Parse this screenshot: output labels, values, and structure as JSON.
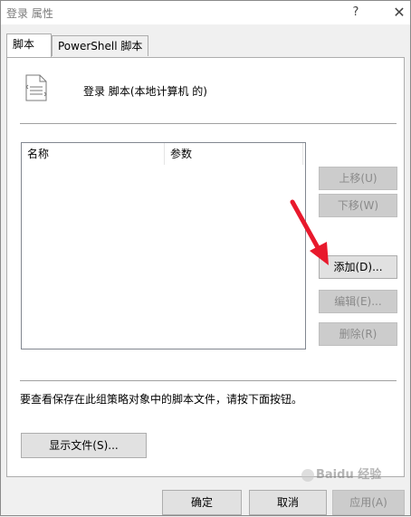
{
  "window": {
    "title": "登录 属性",
    "help_glyph": "?",
    "close_glyph": "✕"
  },
  "tabs": [
    {
      "label": "脚本"
    },
    {
      "label": "PowerShell 脚本"
    }
  ],
  "header": {
    "label": "登录 脚本(本地计算机 的)"
  },
  "list": {
    "columns": [
      "名称",
      "参数"
    ]
  },
  "side_buttons": {
    "up": "上移(U)",
    "down": "下移(W)",
    "add": "添加(D)...",
    "edit": "编辑(E)...",
    "remove": "删除(R)"
  },
  "info_text": "要查看保存在此组策略对象中的脚本文件，请按下面按钮。",
  "show_files_label": "显示文件(S)...",
  "footer": {
    "ok": "确定",
    "cancel": "取消",
    "apply": "应用(A)"
  },
  "watermark": "Baidu 经验",
  "colors": {
    "arrow": "#e8192c"
  }
}
